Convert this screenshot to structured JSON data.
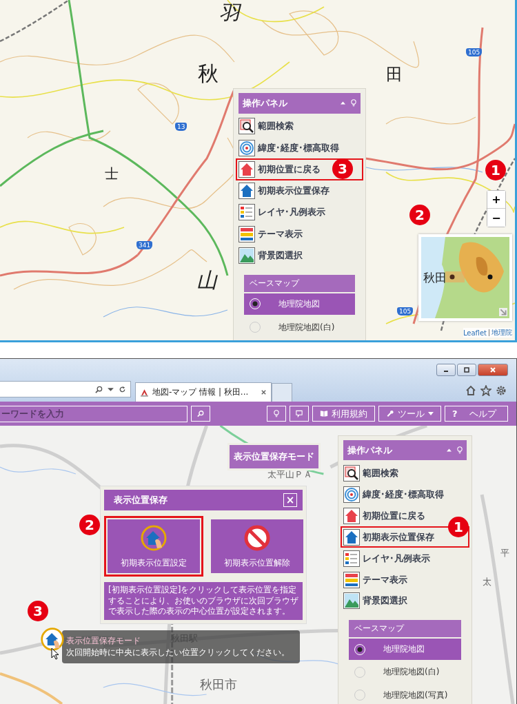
{
  "top_view": {
    "map_labels": [
      "羽",
      "秋",
      "田",
      "士",
      "山"
    ],
    "road_numbers": [
      "13",
      "105",
      "341",
      "105"
    ],
    "control_panel": {
      "title": "操作パネル",
      "items": [
        {
          "label": "範囲検索",
          "highlighted": false
        },
        {
          "label": "緯度･経度･標高取得",
          "highlighted": false
        },
        {
          "label": "初期位置に戻る",
          "highlighted": true
        },
        {
          "label": "初期表示位置保存",
          "highlighted": false
        },
        {
          "label": "レイヤ･凡例表示",
          "highlighted": false
        },
        {
          "label": "テーマ表示",
          "highlighted": false
        },
        {
          "label": "背景図選択",
          "highlighted": false
        }
      ],
      "basemap": {
        "heading": "ベースマップ",
        "options": [
          {
            "label": "地理院地図",
            "selected": true
          },
          {
            "label": "地理院地図(白)",
            "selected": false
          }
        ]
      }
    },
    "zoom_controls": [
      "+",
      "−"
    ],
    "minimap": {
      "label": "秋田"
    },
    "attribution": [
      "Leaflet",
      "地理院"
    ],
    "callouts": [
      "1",
      "2",
      "3"
    ]
  },
  "bottom_view": {
    "tab": {
      "title": "地図-マップ 情報 | 秋田..."
    },
    "search": {
      "placeholder": "ーワードを入力"
    },
    "toolbar_buttons": [
      {
        "label": "利用規約"
      },
      {
        "label": "ツール"
      },
      {
        "label": "ヘルプ",
        "glyph": "?"
      }
    ],
    "map_labels": [
      "太平山ＰＡ",
      "平",
      "太",
      "秋田駅",
      "秋田市"
    ],
    "mode_badge": "表示位置保存モード",
    "dialog": {
      "title": "表示位置保存",
      "close": "×",
      "options": [
        {
          "label": "初期表示位置設定",
          "highlighted": true
        },
        {
          "label": "初期表示位置解除",
          "highlighted": false
        }
      ],
      "description": "[初期表示位置設定]をクリックして表示位置を指定することにより、お使いのブラウザに次回ブラウザで表示した際の表示の中心位置が設定されます。"
    },
    "control_panel": {
      "title": "操作パネル",
      "items": [
        {
          "label": "範囲検索",
          "highlighted": false
        },
        {
          "label": "緯度･経度･標高取得",
          "highlighted": false
        },
        {
          "label": "初期位置に戻る",
          "highlighted": false
        },
        {
          "label": "初期表示位置保存",
          "highlighted": true
        },
        {
          "label": "レイヤ･凡例表示",
          "highlighted": false
        },
        {
          "label": "テーマ表示",
          "highlighted": false
        },
        {
          "label": "背景図選択",
          "highlighted": false
        }
      ],
      "basemap": {
        "heading": "ベースマップ",
        "options": [
          {
            "label": "地理院地図",
            "selected": true
          },
          {
            "label": "地理院地図(白)",
            "selected": false
          },
          {
            "label": "地理院地図(写真)",
            "selected": false
          }
        ]
      }
    },
    "tooltip": {
      "title": "表示位置保存モード",
      "text": "次回開始時に中央に表示したい位置クリックしてください。"
    },
    "callouts": [
      "1",
      "2",
      "3"
    ]
  }
}
